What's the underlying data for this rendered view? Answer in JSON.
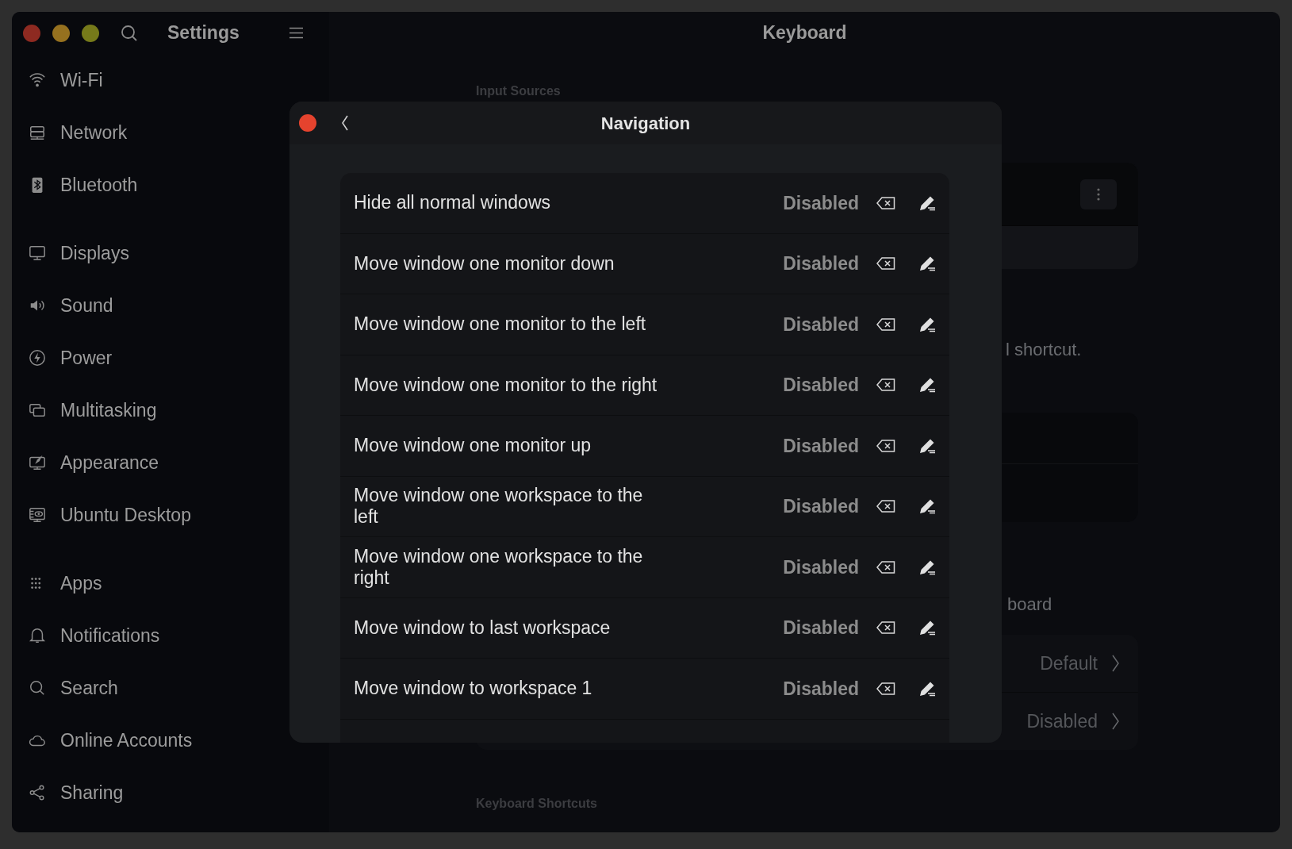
{
  "window": {
    "title": "Keyboard"
  },
  "sidebar": {
    "title": "Settings",
    "sections": [
      {
        "items": [
          {
            "label": "Wi-Fi"
          },
          {
            "label": "Network"
          },
          {
            "label": "Bluetooth"
          }
        ]
      },
      {
        "items": [
          {
            "label": "Displays"
          },
          {
            "label": "Sound"
          },
          {
            "label": "Power"
          },
          {
            "label": "Multitasking"
          },
          {
            "label": "Appearance"
          },
          {
            "label": "Ubuntu Desktop"
          }
        ]
      },
      {
        "items": [
          {
            "label": "Apps"
          },
          {
            "label": "Notifications"
          },
          {
            "label": "Search"
          },
          {
            "label": "Online Accounts"
          },
          {
            "label": "Sharing"
          }
        ]
      }
    ]
  },
  "background": {
    "input_sources_heading": "Input Sources",
    "text_fragment_1": "l shortcut.",
    "text_fragment_2": "board",
    "rows": [
      {
        "value": "Default"
      },
      {
        "value": "Disabled"
      }
    ],
    "shortcuts_heading": "Keyboard Shortcuts"
  },
  "dialog": {
    "title": "Navigation",
    "shortcuts": [
      {
        "label": "Hide all normal windows",
        "accel": "Disabled"
      },
      {
        "label": "Move window one monitor down",
        "accel": "Disabled"
      },
      {
        "label": "Move window one monitor to the left",
        "accel": "Disabled"
      },
      {
        "label": "Move window one monitor to the right",
        "accel": "Disabled"
      },
      {
        "label": "Move window one monitor up",
        "accel": "Disabled"
      },
      {
        "label": "Move window one workspace to the left",
        "accel": "Disabled"
      },
      {
        "label": "Move window one workspace to the right",
        "accel": "Disabled"
      },
      {
        "label": "Move window to last workspace",
        "accel": "Disabled"
      },
      {
        "label": "Move window to workspace 1",
        "accel": "Disabled"
      }
    ]
  }
}
